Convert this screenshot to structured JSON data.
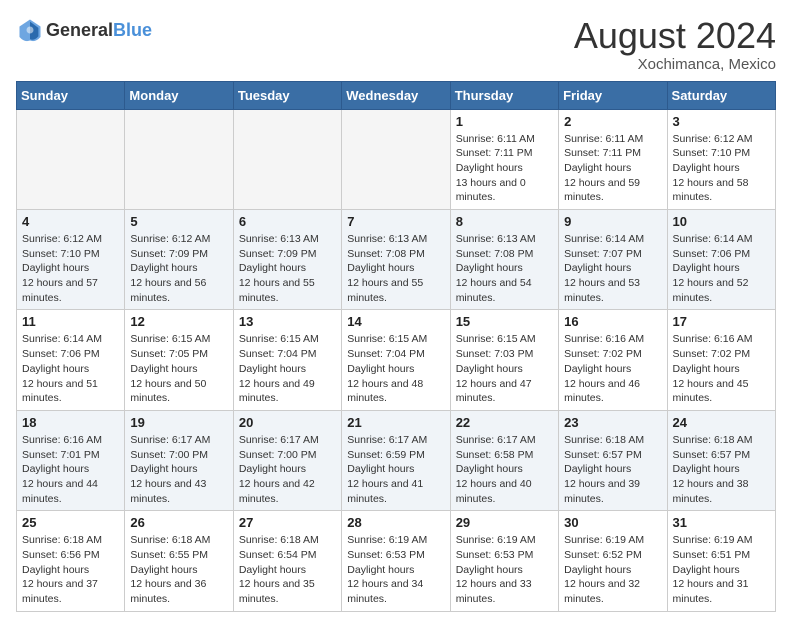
{
  "header": {
    "logo_general": "General",
    "logo_blue": "Blue",
    "month_year": "August 2024",
    "location": "Xochimanca, Mexico"
  },
  "days_of_week": [
    "Sunday",
    "Monday",
    "Tuesday",
    "Wednesday",
    "Thursday",
    "Friday",
    "Saturday"
  ],
  "weeks": [
    [
      {
        "day": "",
        "empty": true
      },
      {
        "day": "",
        "empty": true
      },
      {
        "day": "",
        "empty": true
      },
      {
        "day": "",
        "empty": true
      },
      {
        "day": "1",
        "sunrise": "6:11 AM",
        "sunset": "7:11 PM",
        "daylight": "13 hours and 0 minutes."
      },
      {
        "day": "2",
        "sunrise": "6:11 AM",
        "sunset": "7:11 PM",
        "daylight": "12 hours and 59 minutes."
      },
      {
        "day": "3",
        "sunrise": "6:12 AM",
        "sunset": "7:10 PM",
        "daylight": "12 hours and 58 minutes."
      }
    ],
    [
      {
        "day": "4",
        "sunrise": "6:12 AM",
        "sunset": "7:10 PM",
        "daylight": "12 hours and 57 minutes."
      },
      {
        "day": "5",
        "sunrise": "6:12 AM",
        "sunset": "7:09 PM",
        "daylight": "12 hours and 56 minutes."
      },
      {
        "day": "6",
        "sunrise": "6:13 AM",
        "sunset": "7:09 PM",
        "daylight": "12 hours and 55 minutes."
      },
      {
        "day": "7",
        "sunrise": "6:13 AM",
        "sunset": "7:08 PM",
        "daylight": "12 hours and 55 minutes."
      },
      {
        "day": "8",
        "sunrise": "6:13 AM",
        "sunset": "7:08 PM",
        "daylight": "12 hours and 54 minutes."
      },
      {
        "day": "9",
        "sunrise": "6:14 AM",
        "sunset": "7:07 PM",
        "daylight": "12 hours and 53 minutes."
      },
      {
        "day": "10",
        "sunrise": "6:14 AM",
        "sunset": "7:06 PM",
        "daylight": "12 hours and 52 minutes."
      }
    ],
    [
      {
        "day": "11",
        "sunrise": "6:14 AM",
        "sunset": "7:06 PM",
        "daylight": "12 hours and 51 minutes."
      },
      {
        "day": "12",
        "sunrise": "6:15 AM",
        "sunset": "7:05 PM",
        "daylight": "12 hours and 50 minutes."
      },
      {
        "day": "13",
        "sunrise": "6:15 AM",
        "sunset": "7:04 PM",
        "daylight": "12 hours and 49 minutes."
      },
      {
        "day": "14",
        "sunrise": "6:15 AM",
        "sunset": "7:04 PM",
        "daylight": "12 hours and 48 minutes."
      },
      {
        "day": "15",
        "sunrise": "6:15 AM",
        "sunset": "7:03 PM",
        "daylight": "12 hours and 47 minutes."
      },
      {
        "day": "16",
        "sunrise": "6:16 AM",
        "sunset": "7:02 PM",
        "daylight": "12 hours and 46 minutes."
      },
      {
        "day": "17",
        "sunrise": "6:16 AM",
        "sunset": "7:02 PM",
        "daylight": "12 hours and 45 minutes."
      }
    ],
    [
      {
        "day": "18",
        "sunrise": "6:16 AM",
        "sunset": "7:01 PM",
        "daylight": "12 hours and 44 minutes."
      },
      {
        "day": "19",
        "sunrise": "6:17 AM",
        "sunset": "7:00 PM",
        "daylight": "12 hours and 43 minutes."
      },
      {
        "day": "20",
        "sunrise": "6:17 AM",
        "sunset": "7:00 PM",
        "daylight": "12 hours and 42 minutes."
      },
      {
        "day": "21",
        "sunrise": "6:17 AM",
        "sunset": "6:59 PM",
        "daylight": "12 hours and 41 minutes."
      },
      {
        "day": "22",
        "sunrise": "6:17 AM",
        "sunset": "6:58 PM",
        "daylight": "12 hours and 40 minutes."
      },
      {
        "day": "23",
        "sunrise": "6:18 AM",
        "sunset": "6:57 PM",
        "daylight": "12 hours and 39 minutes."
      },
      {
        "day": "24",
        "sunrise": "6:18 AM",
        "sunset": "6:57 PM",
        "daylight": "12 hours and 38 minutes."
      }
    ],
    [
      {
        "day": "25",
        "sunrise": "6:18 AM",
        "sunset": "6:56 PM",
        "daylight": "12 hours and 37 minutes."
      },
      {
        "day": "26",
        "sunrise": "6:18 AM",
        "sunset": "6:55 PM",
        "daylight": "12 hours and 36 minutes."
      },
      {
        "day": "27",
        "sunrise": "6:18 AM",
        "sunset": "6:54 PM",
        "daylight": "12 hours and 35 minutes."
      },
      {
        "day": "28",
        "sunrise": "6:19 AM",
        "sunset": "6:53 PM",
        "daylight": "12 hours and 34 minutes."
      },
      {
        "day": "29",
        "sunrise": "6:19 AM",
        "sunset": "6:53 PM",
        "daylight": "12 hours and 33 minutes."
      },
      {
        "day": "30",
        "sunrise": "6:19 AM",
        "sunset": "6:52 PM",
        "daylight": "12 hours and 32 minutes."
      },
      {
        "day": "31",
        "sunrise": "6:19 AM",
        "sunset": "6:51 PM",
        "daylight": "12 hours and 31 minutes."
      }
    ]
  ]
}
